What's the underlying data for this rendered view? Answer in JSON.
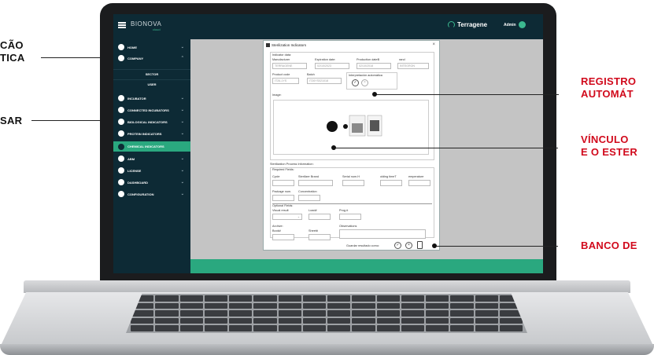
{
  "callouts": {
    "left_1_line1": "CÃO",
    "left_1_line2": "TICA",
    "left_2": "SAR",
    "right_1_line1": "REGISTRO",
    "right_1_line2": "AUTOMÁT",
    "right_2_line1": "VÍNCULO",
    "right_2_line2": "E O ESTER",
    "right_3": "BANCO DE"
  },
  "topbar": {
    "logo": "BIONOVA",
    "logo_sub": "cloud",
    "brand": "Terragene",
    "user": "Admin"
  },
  "sidebar": {
    "items": [
      {
        "label": "HOME",
        "icon": "home-icon"
      },
      {
        "label": "COMPANY",
        "icon": "building-icon"
      },
      {
        "label": "SECTOR"
      },
      {
        "label": "USER"
      },
      {
        "label": "INCUBATOR",
        "icon": "incubator-icon"
      },
      {
        "label": "CONNECTED INCUBATORS",
        "icon": "connected-icon"
      },
      {
        "label": "BIOLOGICAL INDICATORS",
        "icon": "biological-icon"
      },
      {
        "label": "PROTEIN INDICATORS",
        "icon": "protein-icon"
      },
      {
        "label": "CHEMICAL INDICATORS",
        "icon": "chemical-icon"
      },
      {
        "label": "ABM",
        "icon": "abm-icon"
      },
      {
        "label": "LICENSE",
        "icon": "license-icon"
      },
      {
        "label": "DASHBOARD",
        "icon": "dashboard-icon"
      },
      {
        "label": "CONFIGURATION",
        "icon": "gear-icon"
      }
    ],
    "active": "CHEMICAL INDICATORS"
  },
  "dialog": {
    "title": "Sterilization Indicators",
    "indicator_data_label": "Indicator data:",
    "manufacturer_label": "Manufacturer",
    "manufacturer_value": "TERRAGENE",
    "expiration_label": "Expiration date:",
    "expiration_value": "02/10/2023",
    "production_label": "Production dateB",
    "production_value": "02/10/2018",
    "brand_label": "rand",
    "brand_value": "INTEGRON",
    "product_code_label": "Product code",
    "product_code_value": "IT26-1YS",
    "batch_label": "Batch",
    "batch_value": "IT26YS021018",
    "auto_interp_label": "Interpretación automática",
    "image_label": "Image:",
    "process_info_label": "Sterilization Process Information:",
    "required_label": "Required Fields:",
    "cycle_label": "Cycle",
    "sterilizer_brand_label": "Sterilizer Brand",
    "serial_label": "Serial num.H",
    "olding_label": "olding timeT",
    "emperature_label": "emperature",
    "package_label": "Package num.",
    "concentration_label": "Concentration",
    "optional_label": "Optional Fields:",
    "visual_result_label": "Visual result",
    "load_label": "Load#",
    "prog_label": "Prog.#",
    "archive_label": "Archive:",
    "book_label": "Book#",
    "sheet_label": "Sheet#",
    "observations_label": "Observations",
    "save_result_label": "Guardar resultado como:"
  }
}
